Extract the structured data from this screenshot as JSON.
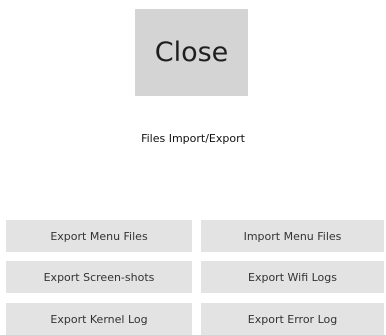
{
  "close_button": {
    "label": "Close"
  },
  "section": {
    "title": "Files Import/Export"
  },
  "actions": [
    {
      "label": "Export Menu Files"
    },
    {
      "label": "Import Menu Files"
    },
    {
      "label": "Export Screen-shots"
    },
    {
      "label": "Export Wifi Logs"
    },
    {
      "label": "Export Kernel Log"
    },
    {
      "label": "Export Error Log"
    }
  ]
}
